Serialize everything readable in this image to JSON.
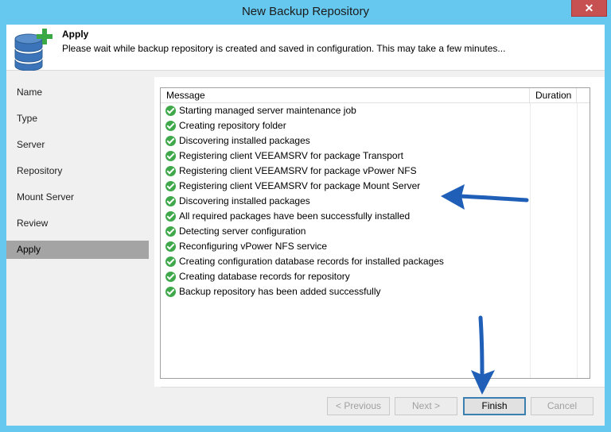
{
  "window": {
    "title": "New Backup Repository",
    "close_glyph": "✕"
  },
  "header": {
    "title": "Apply",
    "subtitle": "Please wait while backup repository is created and saved in configuration. This may take a few minutes...",
    "icon": "database-add-icon"
  },
  "nav": {
    "items": [
      {
        "label": "Name"
      },
      {
        "label": "Type"
      },
      {
        "label": "Server"
      },
      {
        "label": "Repository"
      },
      {
        "label": "Mount Server"
      },
      {
        "label": "Review"
      },
      {
        "label": "Apply",
        "active": true
      }
    ]
  },
  "grid": {
    "columns": [
      "Message",
      "Duration"
    ],
    "rows": [
      {
        "status": "success",
        "message": "Starting managed server maintenance job",
        "duration": ""
      },
      {
        "status": "success",
        "message": "Creating repository folder",
        "duration": ""
      },
      {
        "status": "success",
        "message": "Discovering installed packages",
        "duration": ""
      },
      {
        "status": "success",
        "message": "Registering client VEEAMSRV for package Transport",
        "duration": ""
      },
      {
        "status": "success",
        "message": "Registering client VEEAMSRV for package vPower NFS",
        "duration": ""
      },
      {
        "status": "success",
        "message": "Registering client VEEAMSRV for package Mount Server",
        "duration": ""
      },
      {
        "status": "success",
        "message": "Discovering installed packages",
        "duration": ""
      },
      {
        "status": "success",
        "message": "All required packages have been successfully installed",
        "duration": ""
      },
      {
        "status": "success",
        "message": "Detecting server configuration",
        "duration": ""
      },
      {
        "status": "success",
        "message": "Reconfiguring vPower NFS service",
        "duration": ""
      },
      {
        "status": "success",
        "message": "Creating configuration database records for installed packages",
        "duration": ""
      },
      {
        "status": "success",
        "message": "Creating database records for repository",
        "duration": ""
      },
      {
        "status": "success",
        "message": "Backup repository has been added successfully",
        "duration": ""
      }
    ]
  },
  "buttons": {
    "previous": "< Previous",
    "next": "Next >",
    "finish": "Finish",
    "cancel": "Cancel"
  },
  "colors": {
    "titlebar": "#66c7ef",
    "success": "#3fa84a",
    "annotation_arrow": "#1f5fb8"
  }
}
